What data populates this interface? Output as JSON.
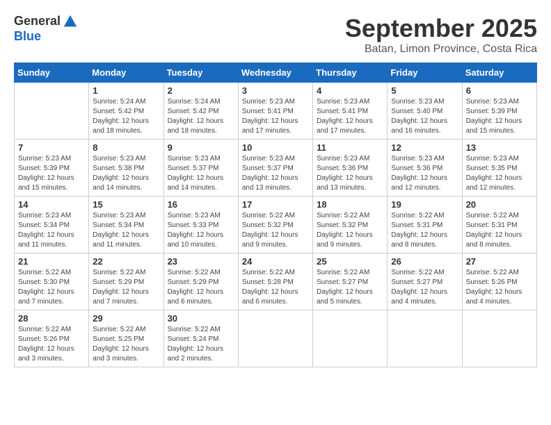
{
  "header": {
    "logo": {
      "line1": "General",
      "line2": "Blue"
    },
    "title": "September 2025",
    "subtitle": "Batan, Limon Province, Costa Rica"
  },
  "weekdays": [
    "Sunday",
    "Monday",
    "Tuesday",
    "Wednesday",
    "Thursday",
    "Friday",
    "Saturday"
  ],
  "weeks": [
    [
      {
        "day": "",
        "info": ""
      },
      {
        "day": "1",
        "info": "Sunrise: 5:24 AM\nSunset: 5:42 PM\nDaylight: 12 hours\nand 18 minutes."
      },
      {
        "day": "2",
        "info": "Sunrise: 5:24 AM\nSunset: 5:42 PM\nDaylight: 12 hours\nand 18 minutes."
      },
      {
        "day": "3",
        "info": "Sunrise: 5:23 AM\nSunset: 5:41 PM\nDaylight: 12 hours\nand 17 minutes."
      },
      {
        "day": "4",
        "info": "Sunrise: 5:23 AM\nSunset: 5:41 PM\nDaylight: 12 hours\nand 17 minutes."
      },
      {
        "day": "5",
        "info": "Sunrise: 5:23 AM\nSunset: 5:40 PM\nDaylight: 12 hours\nand 16 minutes."
      },
      {
        "day": "6",
        "info": "Sunrise: 5:23 AM\nSunset: 5:39 PM\nDaylight: 12 hours\nand 15 minutes."
      }
    ],
    [
      {
        "day": "7",
        "info": "Sunrise: 5:23 AM\nSunset: 5:39 PM\nDaylight: 12 hours\nand 15 minutes."
      },
      {
        "day": "8",
        "info": "Sunrise: 5:23 AM\nSunset: 5:38 PM\nDaylight: 12 hours\nand 14 minutes."
      },
      {
        "day": "9",
        "info": "Sunrise: 5:23 AM\nSunset: 5:37 PM\nDaylight: 12 hours\nand 14 minutes."
      },
      {
        "day": "10",
        "info": "Sunrise: 5:23 AM\nSunset: 5:37 PM\nDaylight: 12 hours\nand 13 minutes."
      },
      {
        "day": "11",
        "info": "Sunrise: 5:23 AM\nSunset: 5:36 PM\nDaylight: 12 hours\nand 13 minutes."
      },
      {
        "day": "12",
        "info": "Sunrise: 5:23 AM\nSunset: 5:36 PM\nDaylight: 12 hours\nand 12 minutes."
      },
      {
        "day": "13",
        "info": "Sunrise: 5:23 AM\nSunset: 5:35 PM\nDaylight: 12 hours\nand 12 minutes."
      }
    ],
    [
      {
        "day": "14",
        "info": "Sunrise: 5:23 AM\nSunset: 5:34 PM\nDaylight: 12 hours\nand 11 minutes."
      },
      {
        "day": "15",
        "info": "Sunrise: 5:23 AM\nSunset: 5:34 PM\nDaylight: 12 hours\nand 11 minutes."
      },
      {
        "day": "16",
        "info": "Sunrise: 5:23 AM\nSunset: 5:33 PM\nDaylight: 12 hours\nand 10 minutes."
      },
      {
        "day": "17",
        "info": "Sunrise: 5:22 AM\nSunset: 5:32 PM\nDaylight: 12 hours\nand 9 minutes."
      },
      {
        "day": "18",
        "info": "Sunrise: 5:22 AM\nSunset: 5:32 PM\nDaylight: 12 hours\nand 9 minutes."
      },
      {
        "day": "19",
        "info": "Sunrise: 5:22 AM\nSunset: 5:31 PM\nDaylight: 12 hours\nand 8 minutes."
      },
      {
        "day": "20",
        "info": "Sunrise: 5:22 AM\nSunset: 5:31 PM\nDaylight: 12 hours\nand 8 minutes."
      }
    ],
    [
      {
        "day": "21",
        "info": "Sunrise: 5:22 AM\nSunset: 5:30 PM\nDaylight: 12 hours\nand 7 minutes."
      },
      {
        "day": "22",
        "info": "Sunrise: 5:22 AM\nSunset: 5:29 PM\nDaylight: 12 hours\nand 7 minutes."
      },
      {
        "day": "23",
        "info": "Sunrise: 5:22 AM\nSunset: 5:29 PM\nDaylight: 12 hours\nand 6 minutes."
      },
      {
        "day": "24",
        "info": "Sunrise: 5:22 AM\nSunset: 5:28 PM\nDaylight: 12 hours\nand 6 minutes."
      },
      {
        "day": "25",
        "info": "Sunrise: 5:22 AM\nSunset: 5:27 PM\nDaylight: 12 hours\nand 5 minutes."
      },
      {
        "day": "26",
        "info": "Sunrise: 5:22 AM\nSunset: 5:27 PM\nDaylight: 12 hours\nand 4 minutes."
      },
      {
        "day": "27",
        "info": "Sunrise: 5:22 AM\nSunset: 5:26 PM\nDaylight: 12 hours\nand 4 minutes."
      }
    ],
    [
      {
        "day": "28",
        "info": "Sunrise: 5:22 AM\nSunset: 5:26 PM\nDaylight: 12 hours\nand 3 minutes."
      },
      {
        "day": "29",
        "info": "Sunrise: 5:22 AM\nSunset: 5:25 PM\nDaylight: 12 hours\nand 3 minutes."
      },
      {
        "day": "30",
        "info": "Sunrise: 5:22 AM\nSunset: 5:24 PM\nDaylight: 12 hours\nand 2 minutes."
      },
      {
        "day": "",
        "info": ""
      },
      {
        "day": "",
        "info": ""
      },
      {
        "day": "",
        "info": ""
      },
      {
        "day": "",
        "info": ""
      }
    ]
  ]
}
